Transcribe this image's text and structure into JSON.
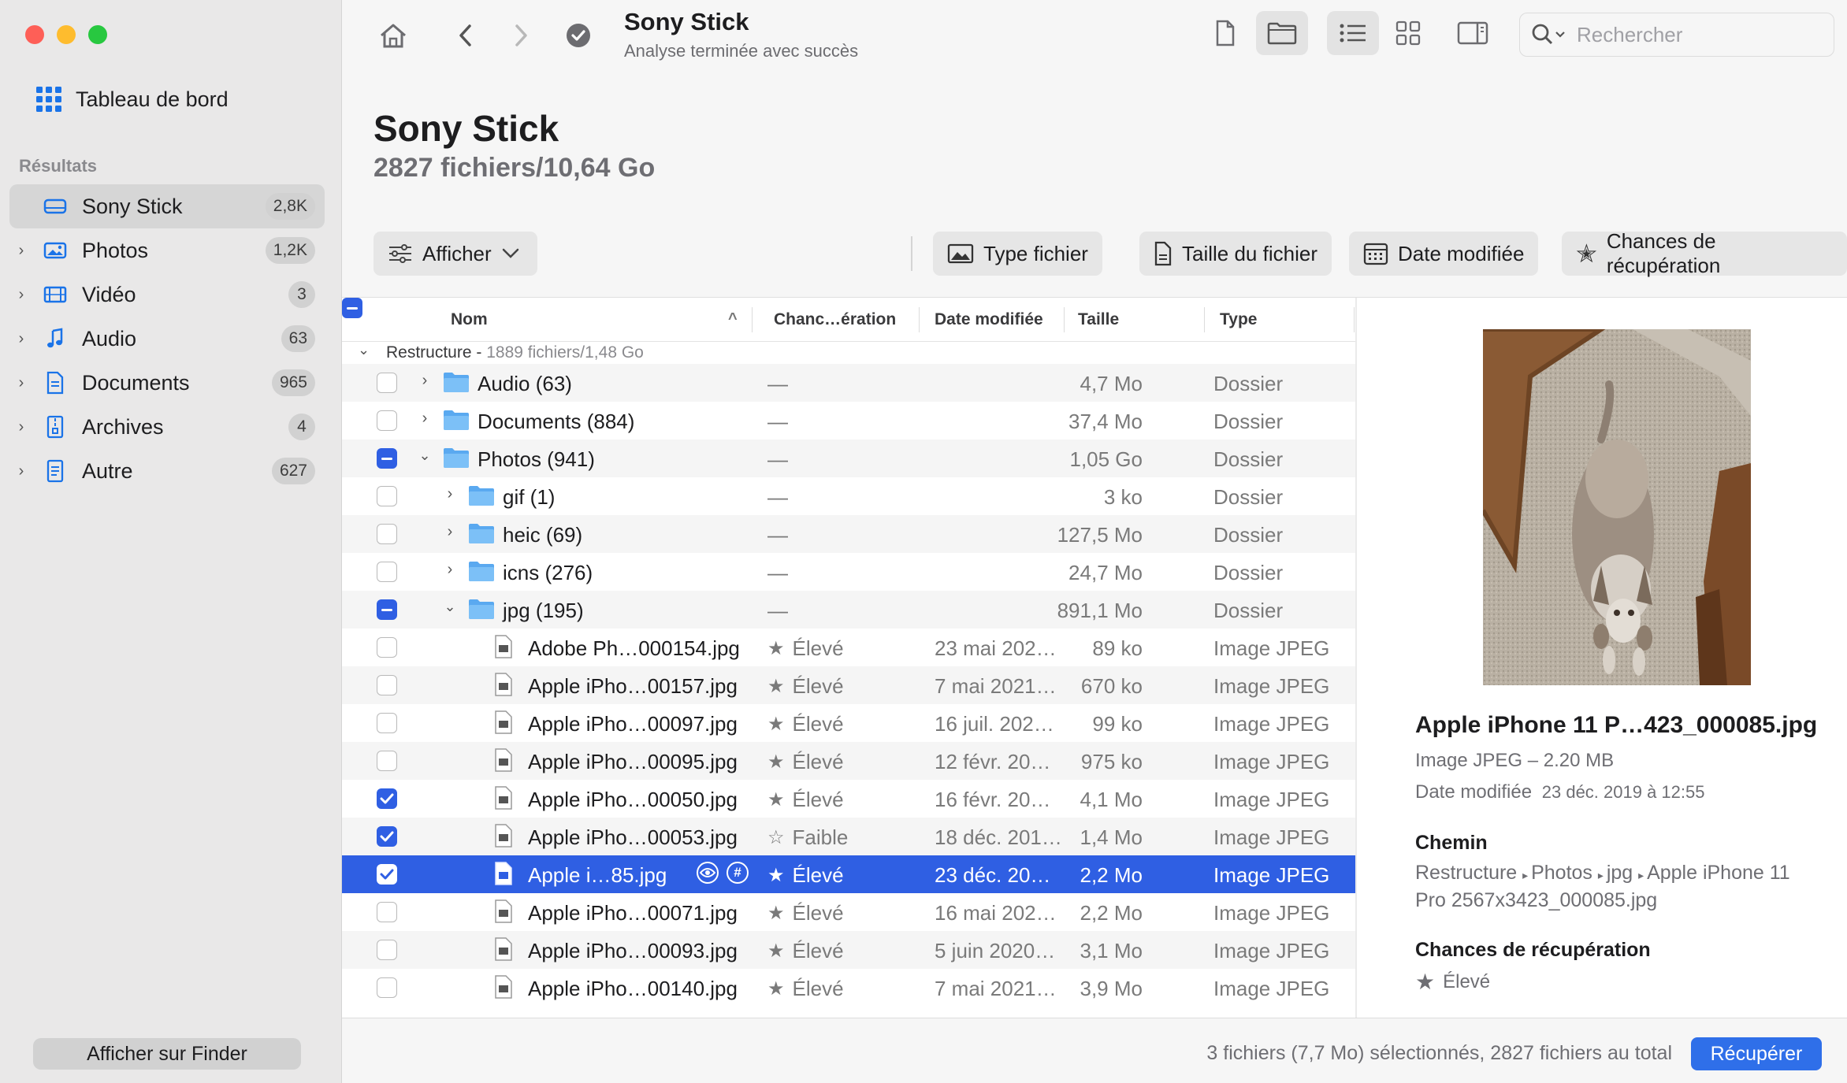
{
  "sidebar": {
    "dashboard_label": "Tableau de bord",
    "section_label": "Résultats",
    "items": [
      {
        "label": "Sony Stick",
        "count": "2,8K"
      },
      {
        "label": "Photos",
        "count": "1,2K"
      },
      {
        "label": "Vidéo",
        "count": "3"
      },
      {
        "label": "Audio",
        "count": "63"
      },
      {
        "label": "Documents",
        "count": "965"
      },
      {
        "label": "Archives",
        "count": "4"
      },
      {
        "label": "Autre",
        "count": "627"
      }
    ],
    "finder_button": "Afficher sur Finder"
  },
  "toolbar": {
    "title": "Sony Stick",
    "subtitle": "Analyse terminée avec succès",
    "search_placeholder": "Rechercher"
  },
  "header": {
    "title": "Sony Stick",
    "subtitle": "2827 fichiers/10,64 Go",
    "filters": {
      "show": "Afficher",
      "file_type": "Type fichier",
      "file_size": "Taille du fichier",
      "date_modified": "Date modifiée",
      "recovery_chances": "Chances de récupération"
    }
  },
  "table": {
    "columns": {
      "name": "Nom",
      "chance": "Chanc…ération",
      "date": "Date modifiée",
      "size": "Taille",
      "type": "Type"
    },
    "group": {
      "name": "Restructure",
      "info": "1889 fichiers/1,48 Go"
    },
    "rows": [
      {
        "name": "Audio (63)",
        "chance": "—",
        "date": "",
        "size": "4,7 Mo",
        "type": "Dossier"
      },
      {
        "name": "Documents (884)",
        "chance": "—",
        "date": "",
        "size": "37,4 Mo",
        "type": "Dossier"
      },
      {
        "name": "Photos (941)",
        "chance": "—",
        "date": "",
        "size": "1,05 Go",
        "type": "Dossier"
      },
      {
        "name": "gif (1)",
        "chance": "—",
        "date": "",
        "size": "3 ko",
        "type": "Dossier"
      },
      {
        "name": "heic (69)",
        "chance": "—",
        "date": "",
        "size": "127,5 Mo",
        "type": "Dossier"
      },
      {
        "name": "icns (276)",
        "chance": "—",
        "date": "",
        "size": "24,7 Mo",
        "type": "Dossier"
      },
      {
        "name": "jpg (195)",
        "chance": "—",
        "date": "",
        "size": "891,1 Mo",
        "type": "Dossier"
      },
      {
        "name": "Adobe Ph…000154.jpg",
        "chance": "Élevé",
        "date": "23 mai 202…",
        "size": "89 ko",
        "type": "Image JPEG"
      },
      {
        "name": "Apple iPho…00157.jpg",
        "chance": "Élevé",
        "date": "7 mai 2021…",
        "size": "670 ko",
        "type": "Image JPEG"
      },
      {
        "name": "Apple iPho…00097.jpg",
        "chance": "Élevé",
        "date": "16 juil. 202…",
        "size": "99 ko",
        "type": "Image JPEG"
      },
      {
        "name": "Apple iPho…00095.jpg",
        "chance": "Élevé",
        "date": "12 févr. 20…",
        "size": "975 ko",
        "type": "Image JPEG"
      },
      {
        "name": "Apple iPho…00050.jpg",
        "chance": "Élevé",
        "date": "16 févr. 20…",
        "size": "4,1 Mo",
        "type": "Image JPEG"
      },
      {
        "name": "Apple iPho…00053.jpg",
        "chance": "Faible",
        "date": "18 déc. 201…",
        "size": "1,4 Mo",
        "type": "Image JPEG"
      },
      {
        "name": "Apple i…85.jpg",
        "chance": "Élevé",
        "date": "23 déc. 20…",
        "size": "2,2 Mo",
        "type": "Image JPEG"
      },
      {
        "name": "Apple iPho…00071.jpg",
        "chance": "Élevé",
        "date": "16 mai 202…",
        "size": "2,2 Mo",
        "type": "Image JPEG"
      },
      {
        "name": "Apple iPho…00093.jpg",
        "chance": "Élevé",
        "date": "5 juin 2020…",
        "size": "3,1 Mo",
        "type": "Image JPEG"
      },
      {
        "name": "Apple iPho…00140.jpg",
        "chance": "Élevé",
        "date": "7 mai 2021…",
        "size": "3,9 Mo",
        "type": "Image JPEG"
      }
    ]
  },
  "preview": {
    "title": "Apple iPhone 11 P…423_000085.jpg",
    "type_size": "Image JPEG – 2.20 MB",
    "date_label": "Date modifiée",
    "date_value": "23 déc. 2019 à 12:55",
    "path_label": "Chemin",
    "path": [
      "Restructure",
      "Photos",
      "jpg",
      "Apple iPhone 11 Pro 2567x3423_000085.jpg"
    ],
    "chance_label": "Chances de récupération",
    "chance_value": "Élevé"
  },
  "footer": {
    "status": "3 fichiers (7,7 Mo) sélectionnés, 2827 fichiers au total",
    "recover_button": "Récupérer"
  },
  "colors": {
    "accent": "#2f5fe3",
    "folder": "#5aa9f0",
    "sidebar_bg": "#e9e8e8"
  }
}
